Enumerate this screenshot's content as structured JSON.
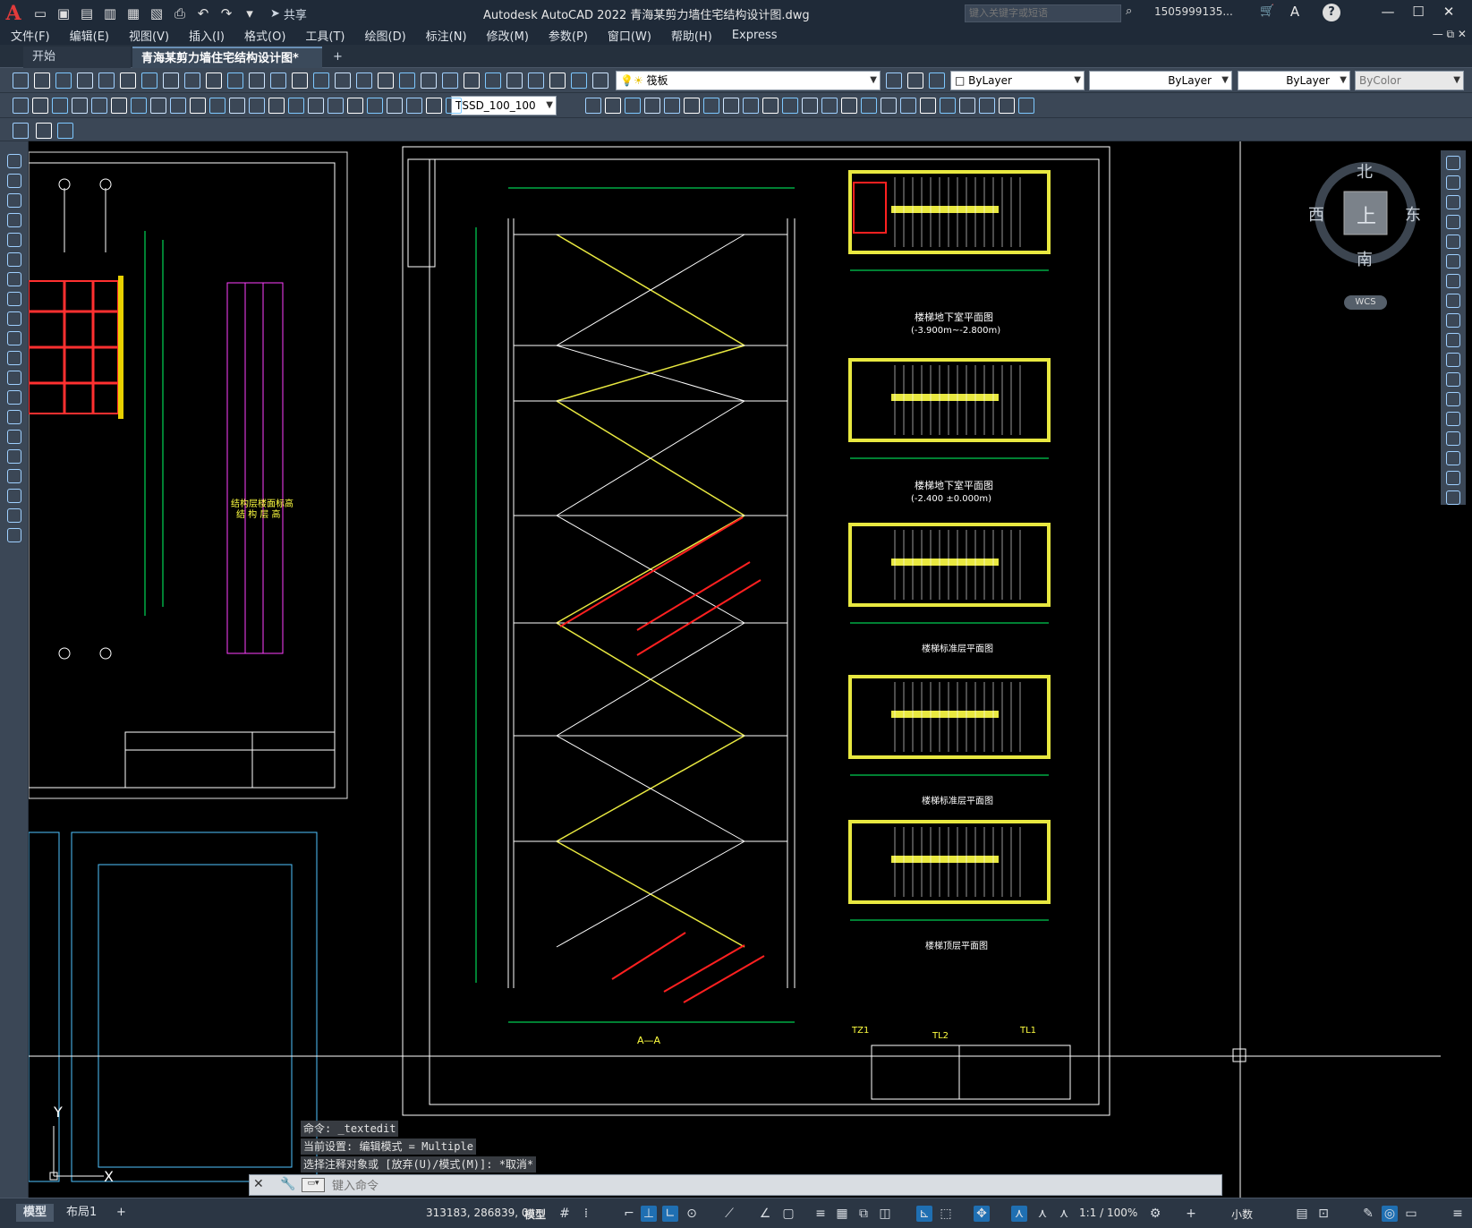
{
  "title_bar": {
    "logo": "A",
    "share_label": "共享",
    "window_title": "Autodesk AutoCAD 2022    青海某剪力墙住宅结构设计图.dwg",
    "search_placeholder": "键入关键字或短语",
    "user_name": "1505999135...",
    "help_icon": "?"
  },
  "menu": [
    "文件(F)",
    "编辑(E)",
    "视图(V)",
    "插入(I)",
    "格式(O)",
    "工具(T)",
    "绘图(D)",
    "标注(N)",
    "修改(M)",
    "参数(P)",
    "窗口(W)",
    "帮助(H)",
    "Express"
  ],
  "tabs": {
    "start": "开始",
    "drawing": "青海某剪力墙住宅结构设计图*",
    "add": "+"
  },
  "toolbar": {
    "layer_name": "筏板",
    "color": "ByLayer",
    "linetype": "ByLayer",
    "lineweight": "ByLayer",
    "plotstyle": "ByColor",
    "dim_style": "TSSD_100_100"
  },
  "viewcube": {
    "north": "北",
    "south": "南",
    "east": "东",
    "west": "西",
    "top": "上",
    "wcs": "WCS"
  },
  "drawing": {
    "section_title": "A—A",
    "plan_titles": [
      "楼梯地下室平面图",
      "(-3.900m~-2.800m)",
      "楼梯地下室平面图",
      "(-2.400 ±0.000m)",
      "楼梯标准层平面图",
      "楼梯标准层平面图",
      "楼梯顶层平面图"
    ],
    "beam_labels": [
      "TZ1",
      "TL2",
      "TL1"
    ],
    "left_table_title": "结构层楼面标高",
    "left_table_subtitle": "结 构 层 高"
  },
  "command": {
    "history": [
      "命令: _textedit",
      "当前设置: 编辑模式 = Multiple",
      "选择注释对象或 [放弃(U)/模式(M)]: *取消*"
    ],
    "prompt_placeholder": "键入命令"
  },
  "status": {
    "layout_tabs": [
      "模型",
      "布局1",
      "+"
    ],
    "coords": "313183, 286839, 0",
    "space": "模型",
    "scale": "1:1 / 100%",
    "units": "小数"
  },
  "colors": {
    "titlebar": "#1f2a38",
    "toolbar": "#3b4756",
    "canvas": "#000000",
    "accent": "#1f6fb2"
  }
}
